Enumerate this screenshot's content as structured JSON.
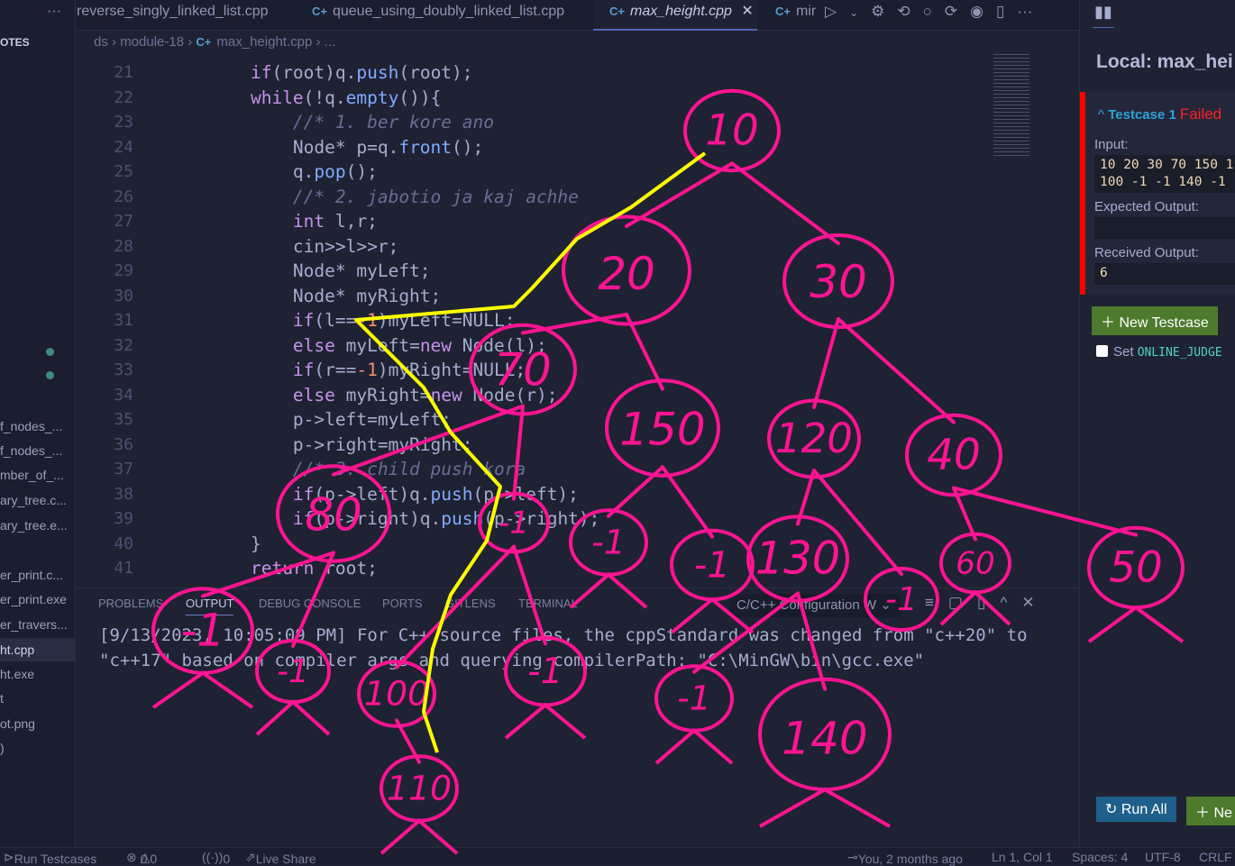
{
  "sidebar": {
    "header": "OTES",
    "items": [
      "f_nodes_...",
      "f_nodes_...",
      "mber_of_...",
      "ary_tree.c...",
      "ary_tree.e...",
      "er_print.c...",
      "er_print.exe",
      "er_travers...",
      "ht.cpp",
      "ht.exe",
      "t",
      "ot.png",
      ")"
    ]
  },
  "tabs": [
    {
      "label": "reverse_singly_linked_list.cpp"
    },
    {
      "label": "queue_using_doubly_linked_list.cpp"
    },
    {
      "label": "max_height.cpp",
      "active": true
    },
    {
      "label": "mir"
    }
  ],
  "more_label": "···",
  "breadcrumb": [
    "ds",
    "module-18",
    "max_height.cpp",
    "..."
  ],
  "code": [
    {
      "n": "21",
      "t": "    if(root)q.push(root);"
    },
    {
      "n": "22",
      "t": "    while(!q.empty()){"
    },
    {
      "n": "23",
      "t": "        //* 1. ber kore ano"
    },
    {
      "n": "24",
      "t": "        Node* p=q.front();"
    },
    {
      "n": "25",
      "t": "        q.pop();"
    },
    {
      "n": "26",
      "t": "        //* 2. jabotio ja kaj achhe"
    },
    {
      "n": "27",
      "t": "        int l,r;"
    },
    {
      "n": "28",
      "t": "        cin>>l>>r;"
    },
    {
      "n": "29",
      "t": "        Node* myLeft;"
    },
    {
      "n": "30",
      "t": "        Node* myRight;"
    },
    {
      "n": "31",
      "t": "        if(l==-1)myLeft=NULL;"
    },
    {
      "n": "32",
      "t": "        else myLeft=new Node(l);"
    },
    {
      "n": "33",
      "t": "        if(r==-1)myRight=NULL;"
    },
    {
      "n": "34",
      "t": "        else myRight=new Node(r);"
    },
    {
      "n": "35",
      "t": "        p->left=myLeft;"
    },
    {
      "n": "36",
      "t": "        p->right=myRight;"
    },
    {
      "n": "37",
      "t": "        //* 3. child push kora"
    },
    {
      "n": "38",
      "t": "        if(p->left)q.push(p->left);"
    },
    {
      "n": "39",
      "t": "        if(p->right)q.push(p->right);"
    },
    {
      "n": "40",
      "t": "    }"
    },
    {
      "n": "41",
      "t": "    return root;"
    }
  ],
  "panel": {
    "tabs": [
      "PROBLEMS",
      "OUTPUT",
      "DEBUG CONSOLE",
      "PORTS",
      "GITLENS",
      "TERMINAL"
    ],
    "active_tab": "OUTPUT",
    "channel": "C/C++ Configuration W",
    "output": "[9/13/2023, 10:05:09 PM] For C++ source files, the cppStandard was changed from \"c++20\" to \"c++17\" based on compiler args and querying compilerPath: \"C:\\MinGW\\bin\\gcc.exe\""
  },
  "right_panel": {
    "title": "Local: max_hei",
    "testcase": {
      "name": "Testcase 1",
      "status": "Failed",
      "input_label": "Input:",
      "input": "10 20 30 70 150 1\n100 -1 -1 140 -1",
      "expected_label": "Expected Output:",
      "expected": "",
      "received_label": "Received Output:",
      "received": "6"
    },
    "new_testcase": "New Testcase",
    "set_label": "Set",
    "online_judge": "ONLINE_JUDGE",
    "run_all": "Run All",
    "new_short": "Ne"
  },
  "status": {
    "run_testcases": "Run Testcases",
    "errors": "0",
    "warnings": "0",
    "ports": "0",
    "live_share": "Live Share",
    "blame": "You, 2 months ago",
    "position": "Ln 1, Col 1",
    "spaces": "Spaces: 4",
    "encoding": "UTF-8",
    "eol": "CRLF"
  },
  "annotation": {
    "color": "#ff1493",
    "path_color": "#ffff00",
    "nodes": [
      "10",
      "20",
      "30",
      "70",
      "150",
      "120",
      "40",
      "80",
      "-1",
      "-1",
      "-1",
      "130",
      "60",
      "50",
      "-1",
      "-1",
      "-1",
      "100",
      "-1",
      "-1",
      "140",
      "110"
    ]
  }
}
